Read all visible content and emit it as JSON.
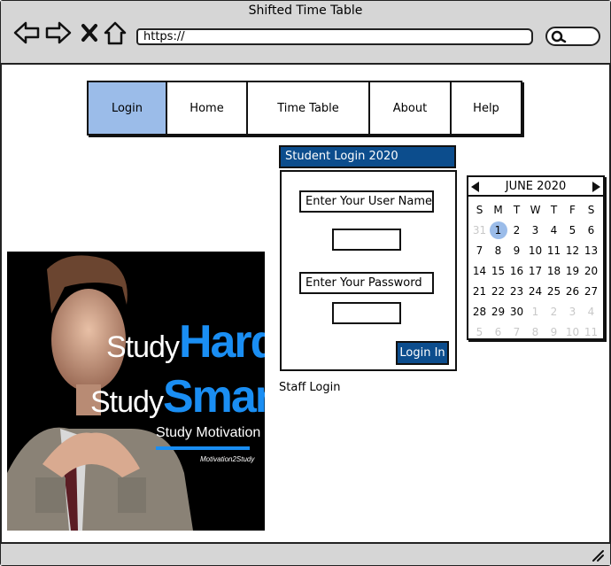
{
  "window": {
    "title": "Shifted Time Table"
  },
  "browser": {
    "url": "https://"
  },
  "nav": {
    "items": [
      "Login",
      "Home",
      "Time Table",
      "About",
      "Help"
    ],
    "active": "Login"
  },
  "hero": {
    "line1a": "Study",
    "line1b": "Hard",
    "line2a": "Study",
    "line2b": "Smart",
    "line3": "Study Motivation",
    "logo": "Motivation2Study"
  },
  "login": {
    "header": "Student Login 2020",
    "username_label": "Enter Your User Name",
    "password_label": "Enter Your Password",
    "button": "Login In",
    "staff_link": "Staff Login"
  },
  "calendar": {
    "month": "JUNE 2020",
    "weekdays": [
      "S",
      "M",
      "T",
      "W",
      "T",
      "F",
      "S"
    ],
    "days": [
      "31",
      "1",
      "2",
      "3",
      "4",
      "5",
      "6",
      "7",
      "8",
      "9",
      "10",
      "11",
      "12",
      "13",
      "14",
      "15",
      "16",
      "17",
      "18",
      "19",
      "20",
      "21",
      "22",
      "23",
      "24",
      "25",
      "26",
      "27",
      "28",
      "29",
      "30",
      "1",
      "2",
      "3",
      "4",
      "5",
      "6",
      "7",
      "8",
      "9",
      "10",
      "11"
    ],
    "today": "1",
    "colors": {
      "today": "#9bbce9",
      "header": "#0c4d8d"
    }
  }
}
